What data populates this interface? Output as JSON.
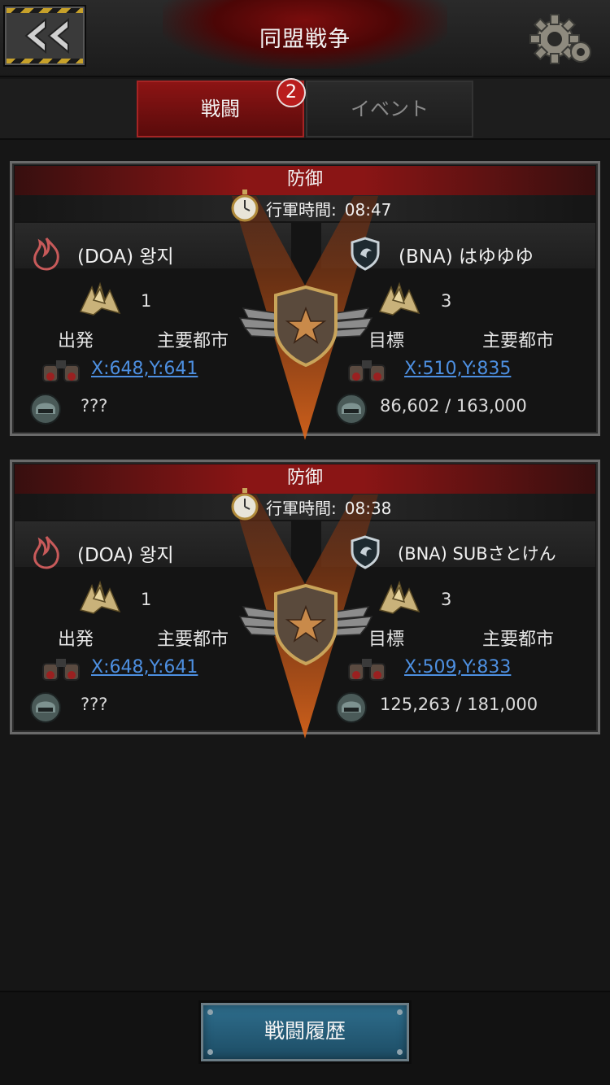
{
  "header": {
    "title": "同盟戦争",
    "back_icon": "double-chevron-left-icon",
    "settings_icon": "gear-icon"
  },
  "tabs": {
    "battle_label": "戦闘",
    "event_label": "イベント",
    "battle_badge": "2"
  },
  "cards": [
    {
      "type_label": "防御",
      "time_label": "行軍時間:",
      "time_value": "08:47",
      "attacker": {
        "name": "(DOA) 왕지",
        "rank_count": "1",
        "role_label": "出発",
        "city_label": "主要都市",
        "coords": "X:648,Y:641",
        "troops": "???"
      },
      "defender": {
        "name": "(BNA) はゆゆゆ",
        "rank_count": "3",
        "role_label": "目標",
        "city_label": "主要都市",
        "coords": "X:510,Y:835",
        "troops": "86,602 / 163,000"
      }
    },
    {
      "type_label": "防御",
      "time_label": "行軍時間:",
      "time_value": "08:38",
      "attacker": {
        "name": "(DOA) 왕지",
        "rank_count": "1",
        "role_label": "出発",
        "city_label": "主要都市",
        "coords": "X:648,Y:641",
        "troops": "???"
      },
      "defender": {
        "name": "(BNA) SUBさとけん",
        "rank_count": "3",
        "role_label": "目標",
        "city_label": "主要都市",
        "coords": "X:509,Y:833",
        "troops": "125,263 / 181,000"
      }
    }
  ],
  "footer": {
    "history_label": "戦闘履歴"
  },
  "colors": {
    "accent_red": "#8a1515",
    "link_blue": "#4d8fe0",
    "button_teal": "#2f6f8e"
  }
}
